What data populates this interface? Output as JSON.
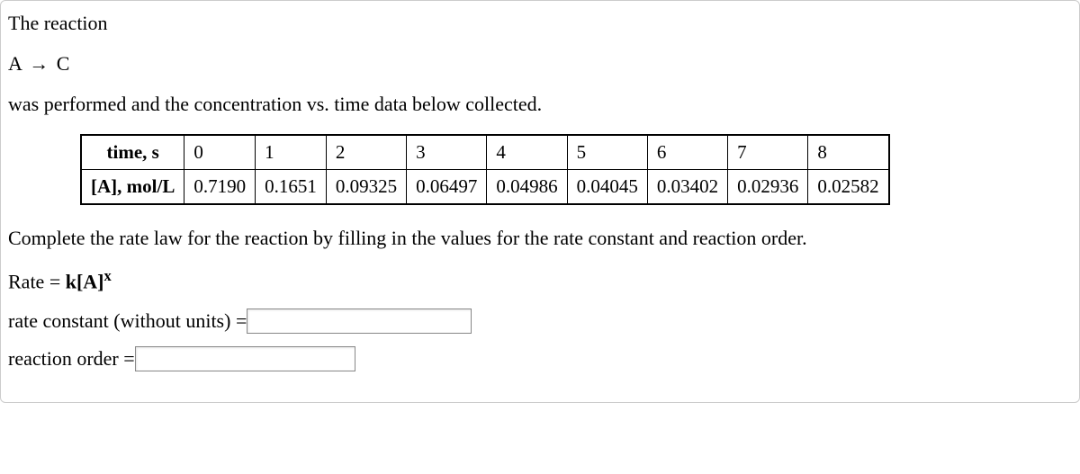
{
  "intro": {
    "line1": "The reaction",
    "equation_lhs": "A",
    "equation_arrow": "→",
    "equation_rhs": "C",
    "line3": "was performed and the concentration vs. time data below collected."
  },
  "table": {
    "row1_header": "time, s",
    "row1": [
      "0",
      "1",
      "2",
      "3",
      "4",
      "5",
      "6",
      "7",
      "8"
    ],
    "row2_header": "[A], mol/L",
    "row2": [
      "0.7190",
      "0.1651",
      "0.09325",
      "0.06497",
      "0.04986",
      "0.04045",
      "0.03402",
      "0.02936",
      "0.02582"
    ]
  },
  "prompt": {
    "text": "Complete the rate law for the reaction by filling in the values for the rate constant and reaction order.",
    "rate_prefix": "Rate = ",
    "rate_formula": "k[A]",
    "rate_exponent": "x",
    "field1_label": "rate constant (without units) = ",
    "field2_label": "reaction order = ",
    "field1_value": "",
    "field2_value": ""
  }
}
